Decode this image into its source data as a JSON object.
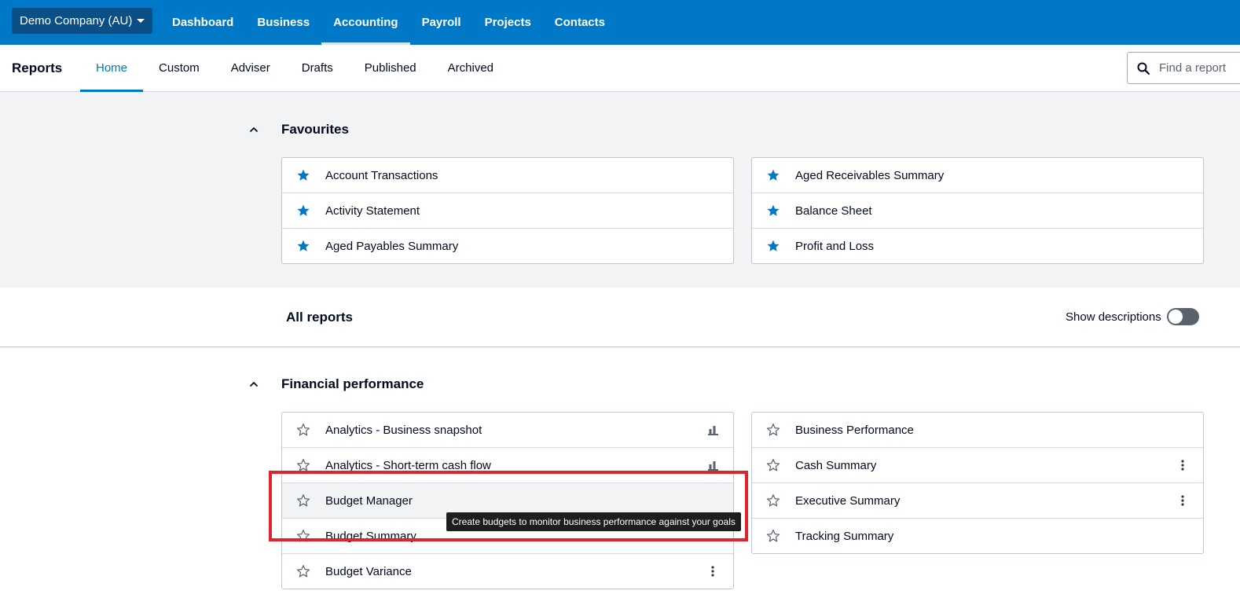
{
  "topnav": {
    "org": "Demo Company (AU)",
    "links": [
      {
        "label": "Dashboard",
        "active": false
      },
      {
        "label": "Business",
        "active": false
      },
      {
        "label": "Accounting",
        "active": true
      },
      {
        "label": "Payroll",
        "active": false
      },
      {
        "label": "Projects",
        "active": false
      },
      {
        "label": "Contacts",
        "active": false
      }
    ]
  },
  "subnav": {
    "title": "Reports",
    "tabs": [
      {
        "label": "Home",
        "active": true
      },
      {
        "label": "Custom",
        "active": false
      },
      {
        "label": "Adviser",
        "active": false
      },
      {
        "label": "Drafts",
        "active": false
      },
      {
        "label": "Published",
        "active": false
      },
      {
        "label": "Archived",
        "active": false
      }
    ],
    "search_placeholder": "Find a report"
  },
  "favourites": {
    "title": "Favourites",
    "left": [
      "Account Transactions",
      "Activity Statement",
      "Aged Payables Summary"
    ],
    "right": [
      "Aged Receivables Summary",
      "Balance Sheet",
      "Profit and Loss"
    ]
  },
  "all_reports": {
    "title": "All reports",
    "show_descriptions": "Show descriptions"
  },
  "financial": {
    "title": "Financial performance",
    "left": [
      {
        "label": "Analytics - Business snapshot",
        "icon": "bar-chart-icon"
      },
      {
        "label": "Analytics - Short-term cash flow",
        "icon": "bar-chart-icon"
      },
      {
        "label": "Budget Manager",
        "icon": ""
      },
      {
        "label": "Budget Summary",
        "icon": ""
      },
      {
        "label": "Budget Variance",
        "icon": "more-icon"
      }
    ],
    "right": [
      {
        "label": "Business Performance",
        "icon": ""
      },
      {
        "label": "Cash Summary",
        "icon": "more-icon"
      },
      {
        "label": "Executive Summary",
        "icon": "more-icon"
      },
      {
        "label": "Tracking Summary",
        "icon": ""
      }
    ]
  },
  "tooltip": "Create budgets to monitor business performance against your goals",
  "colors": {
    "brand": "#0078c8",
    "star": "#0078c8",
    "highlight": "#e0242d"
  }
}
